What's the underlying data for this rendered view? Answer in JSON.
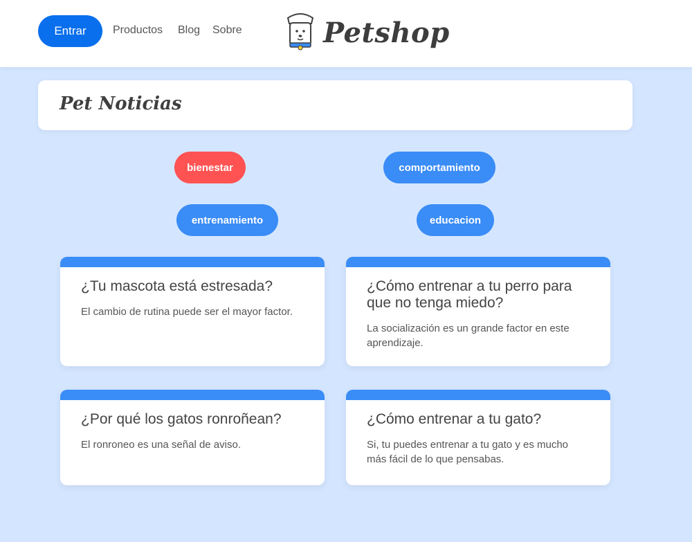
{
  "header": {
    "login_label": "Entrar",
    "nav": [
      {
        "label": "Productos"
      },
      {
        "label": "Blog"
      },
      {
        "label": "Sobre"
      }
    ],
    "brand": "Petshop"
  },
  "page": {
    "title": "Pet Noticias"
  },
  "tags": [
    {
      "label": "bienestar",
      "active": true
    },
    {
      "label": "comportamiento",
      "active": false
    },
    {
      "label": "entrenamiento",
      "active": false
    },
    {
      "label": "educacion",
      "active": false
    }
  ],
  "posts": [
    {
      "title": "¿Tu mascota está estresada?",
      "summary": "El cambio de rutina puede ser el mayor factor."
    },
    {
      "title": "¿Cómo entrenar a tu perro para que no tenga miedo?",
      "summary": "La socialización es un grande factor en este aprendizaje."
    },
    {
      "title": "¿Por qué los gatos ronroñean?",
      "summary": "El ronroneo es una señal de aviso."
    },
    {
      "title": "¿Cómo entrenar a tu gato?",
      "summary": "Si, tu puedes entrenar a tu gato y es mucho más fácil de lo que pensabas."
    }
  ],
  "colors": {
    "background": "#d4e6ff",
    "primary": "#0a6fec",
    "tag": "#3a8cf6",
    "tag_active": "#ff5252"
  },
  "icons": {
    "logo": "dog-logo-icon"
  }
}
